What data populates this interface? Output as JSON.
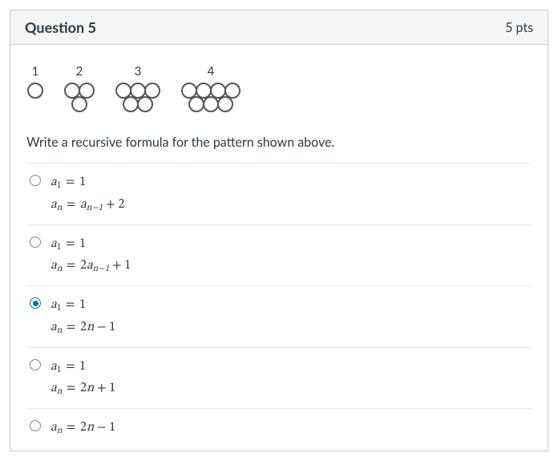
{
  "header": {
    "title": "Question 5",
    "points": "5 pts"
  },
  "pattern": {
    "labels": [
      "1",
      "2",
      "3",
      "4"
    ]
  },
  "prompt": "Write a recursive formula for the pattern shown above.",
  "options": [
    {
      "selected": false,
      "lines": [
        "a₁ = 1",
        "aₙ = aₙ₋₁ + 2"
      ]
    },
    {
      "selected": false,
      "lines": [
        "a₁ = 1",
        "aₙ = 2aₙ₋₁ + 1"
      ]
    },
    {
      "selected": true,
      "lines": [
        "a₁ = 1",
        "aₙ = 2n − 1"
      ]
    },
    {
      "selected": false,
      "lines": [
        "a₁ = 1",
        "aₙ = 2n + 1"
      ]
    },
    {
      "selected": false,
      "lines": [
        "aₙ = 2n − 1"
      ]
    }
  ]
}
